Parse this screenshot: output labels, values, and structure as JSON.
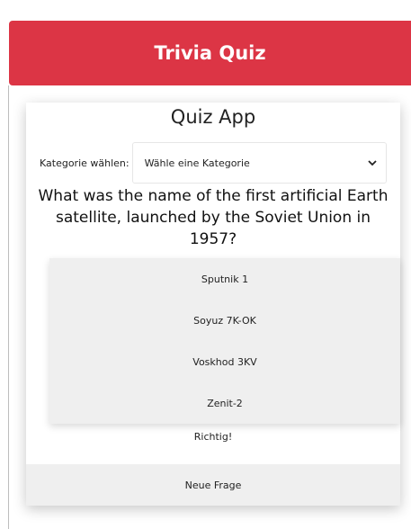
{
  "colors": {
    "header_bg": "#dc3545",
    "answer_bg": "#efefef"
  },
  "header": {
    "title": "Trivia Quiz"
  },
  "card": {
    "title": "Quiz App",
    "category": {
      "label": "Kategorie wählen:",
      "selected": "Wähle eine Kategorie",
      "icon": "chevron-down-icon"
    },
    "question": "What was the name of the first artificial Earth satellite, launched by the Soviet Union in 1957?",
    "answers": [
      {
        "label": "Sputnik 1"
      },
      {
        "label": "Soyuz 7K-OK"
      },
      {
        "label": "Voskhod 3KV"
      },
      {
        "label": "Zenit-2"
      }
    ],
    "result": "Richtig!",
    "new_question_label": "Neue Frage"
  }
}
